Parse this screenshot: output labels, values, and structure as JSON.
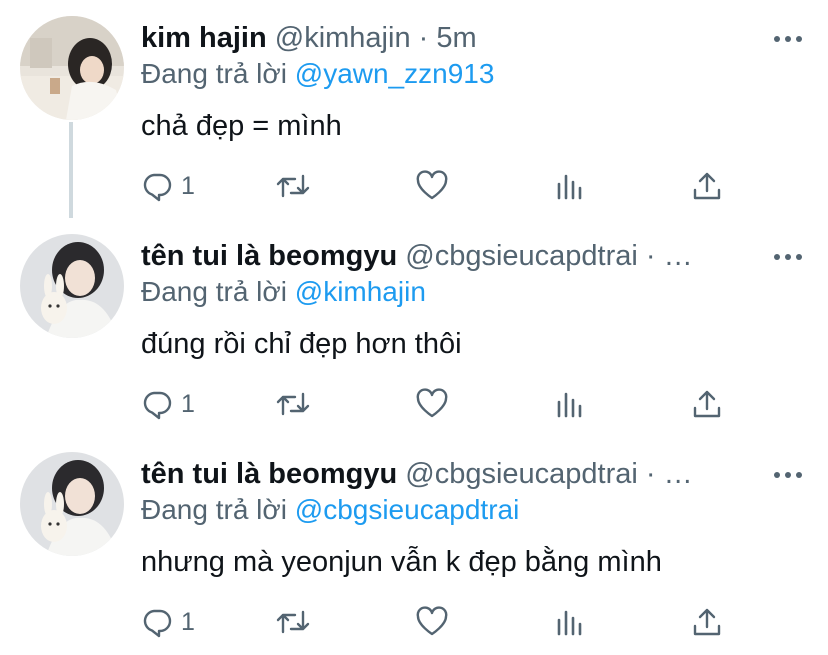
{
  "tweets": [
    {
      "name": "kim hajin",
      "handle": "@kimhajin",
      "meta": " · 5m",
      "reply_prefix": "Đang trả lời ",
      "reply_to": "@yawn_zzn913",
      "text": "chả đẹp = mình",
      "reply_count": "1",
      "avatar": "avatar-photo-girl-desk"
    },
    {
      "name": "tên tui là beomgyu",
      "handle": "@cbgsieucapdtrai",
      "meta": " · …",
      "reply_prefix": "Đang trả lời ",
      "reply_to": "@kimhajin",
      "text": "đúng rồi chỉ đẹp hơn thôi",
      "reply_count": "1",
      "avatar": "avatar-photo-boy-plush"
    },
    {
      "name": "tên tui là beomgyu",
      "handle": "@cbgsieucapdtrai",
      "meta": " · …",
      "reply_prefix": "Đang trả lời ",
      "reply_to": "@cbgsieucapdtrai",
      "text": "nhưng mà yeonjun vẫn k đẹp bằng mình",
      "reply_count": "1",
      "avatar": "avatar-photo-boy-plush"
    }
  ],
  "colors": {
    "text": "#0f1419",
    "secondary": "#536471",
    "link": "#1d9bf0",
    "thread_line": "#cfd9de"
  },
  "icons": [
    "reply-icon",
    "retweet-icon",
    "like-icon",
    "analytics-icon",
    "share-icon",
    "more-icon"
  ]
}
